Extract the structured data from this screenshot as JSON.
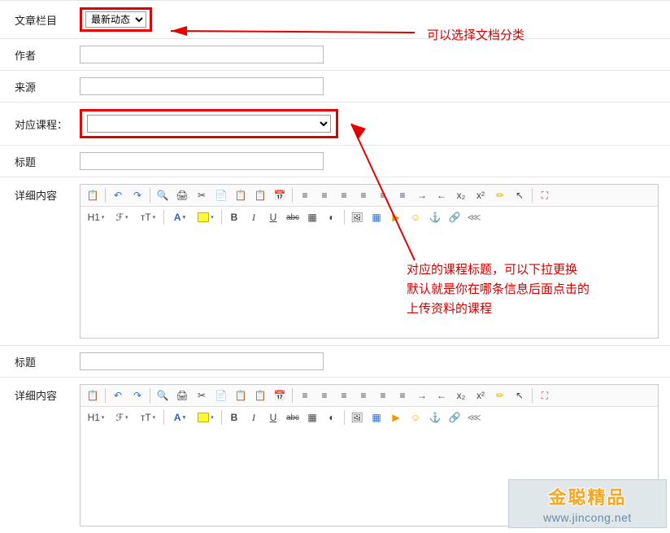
{
  "labels": {
    "category": "文章栏目",
    "author": "作者",
    "source": "来源",
    "course": "对应课程：",
    "title": "标题",
    "content": "详细内容"
  },
  "fields": {
    "category_value": "最新动态",
    "author_value": "",
    "source_value": "",
    "course_value": "",
    "title1_value": "",
    "title2_value": ""
  },
  "annotations": {
    "a1": "可以选择文档分类",
    "a2_line1": "对应的课程标题，可以下拉更换",
    "a2_line2": "默认就是你在哪条信息后面点击的",
    "a2_line3": "上传资料的课程"
  },
  "toolbar": {
    "paste": "📋",
    "undo": "↶",
    "redo": "↷",
    "search": "🔍",
    "print": "🖨",
    "cut": "✂",
    "copy": "📄",
    "pastespecial": "📋",
    "pasteword": "📋",
    "date": "📅",
    "alignleft": "≡",
    "aligncenter": "≡",
    "alignright": "≡",
    "alignfull": "≡",
    "ol": "≡",
    "ul": "≡",
    "indent": "→",
    "outdent": "←",
    "sub": "x₂",
    "sup": "x²",
    "brush": "✏",
    "select": "↖",
    "fullscreen": "⛶",
    "h1": "H1",
    "font": "ℱ",
    "size": "тT",
    "color": "A",
    "bg": "A",
    "bold": "B",
    "italic": "I",
    "under": "U",
    "strike": "abc",
    "grid": "▦",
    "eraser": "◐",
    "img": "🖼",
    "table": "▦",
    "video": "▶",
    "emoji": "☺",
    "anchor": "⚓",
    "link": "🔗",
    "unlink": "⋘"
  },
  "watermark": {
    "title": "金聪精品",
    "url": "www.jincong.net"
  }
}
